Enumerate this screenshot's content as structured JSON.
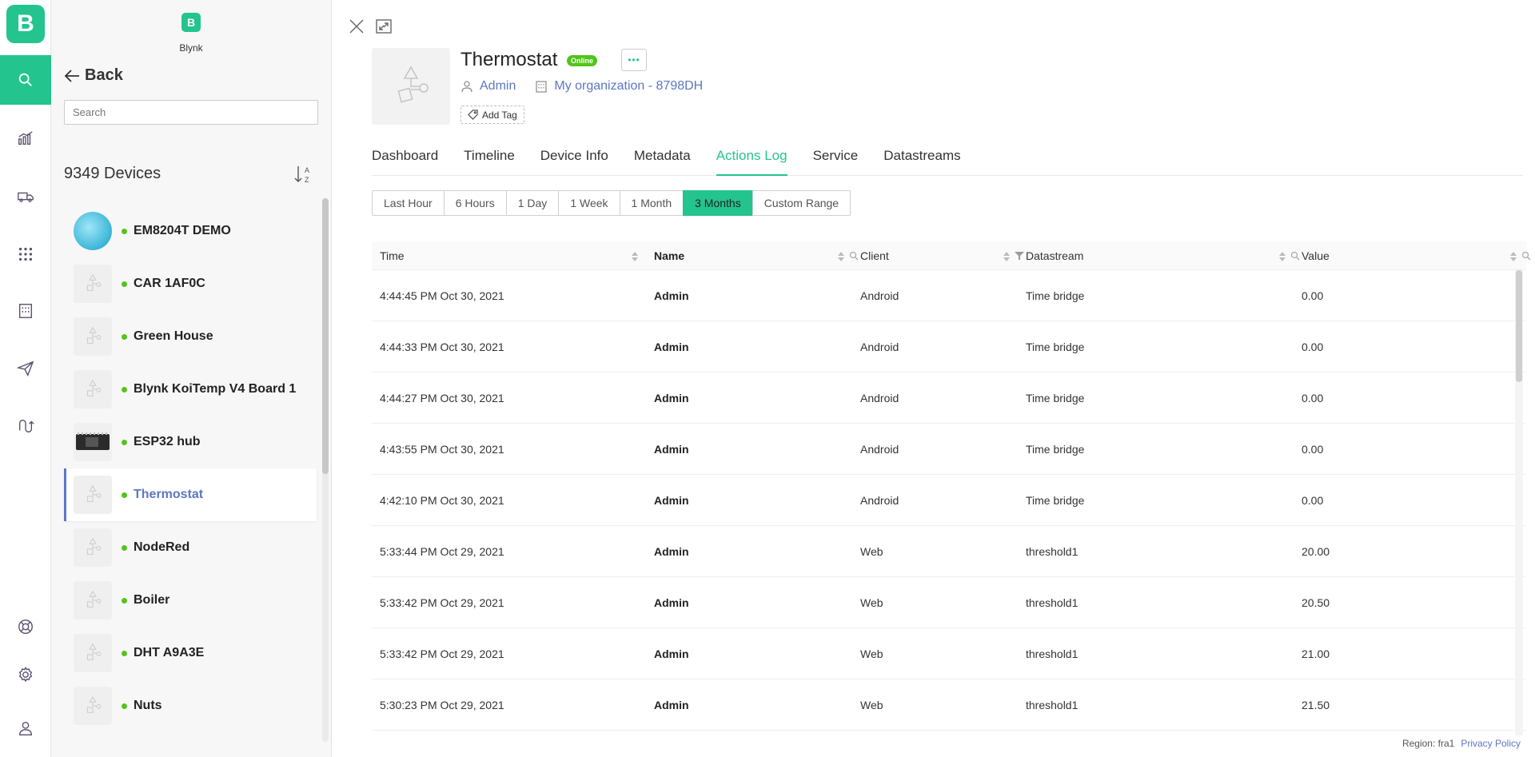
{
  "rail": {
    "logo": "B",
    "items": [
      "search-icon",
      "analytics-icon",
      "truck-icon",
      "apps-icon",
      "building-icon",
      "send-icon",
      "automation-icon"
    ],
    "bottom_items": [
      "help-icon",
      "settings-icon",
      "user-icon"
    ],
    "active_color": "#23c48e"
  },
  "org": {
    "logo": "B",
    "name": "Blynk"
  },
  "panel": {
    "back_label": "Back",
    "search_placeholder": "Search",
    "device_count": "9349 Devices"
  },
  "devices": [
    {
      "name": "EM8204T DEMO",
      "status": "online",
      "thumb": "globe"
    },
    {
      "name": "CAR 1AF0C",
      "status": "online",
      "thumb": "placeholder"
    },
    {
      "name": "Green House",
      "status": "online",
      "thumb": "placeholder"
    },
    {
      "name": "Blynk KoiTemp V4 Board 1",
      "status": "online",
      "thumb": "placeholder"
    },
    {
      "name": "ESP32 hub",
      "status": "online",
      "thumb": "board"
    },
    {
      "name": "Thermostat",
      "status": "online",
      "thumb": "placeholder",
      "selected": true
    },
    {
      "name": "NodeRed",
      "status": "online",
      "thumb": "placeholder"
    },
    {
      "name": "Boiler",
      "status": "online",
      "thumb": "placeholder"
    },
    {
      "name": "DHT A9A3E",
      "status": "online",
      "thumb": "placeholder"
    },
    {
      "name": "Nuts",
      "status": "online",
      "thumb": "placeholder"
    }
  ],
  "device": {
    "title": "Thermostat",
    "status_badge": "Online",
    "owner": "Admin",
    "organization": "My organization - 8798DH",
    "add_tag": "Add Tag"
  },
  "tabs": [
    "Dashboard",
    "Timeline",
    "Device Info",
    "Metadata",
    "Actions Log",
    "Service",
    "Datastreams"
  ],
  "active_tab": "Actions Log",
  "ranges": [
    "Last Hour",
    "6 Hours",
    "1 Day",
    "1 Week",
    "1 Month",
    "3 Months",
    "Custom Range"
  ],
  "active_range": "3 Months",
  "table": {
    "columns": [
      "Time",
      "Name",
      "Client",
      "Datastream",
      "Value"
    ],
    "rows": [
      [
        "4:44:45 PM Oct 30, 2021",
        "Admin",
        "Android",
        "Time bridge",
        "0.00"
      ],
      [
        "4:44:33 PM Oct 30, 2021",
        "Admin",
        "Android",
        "Time bridge",
        "0.00"
      ],
      [
        "4:44:27 PM Oct 30, 2021",
        "Admin",
        "Android",
        "Time bridge",
        "0.00"
      ],
      [
        "4:43:55 PM Oct 30, 2021",
        "Admin",
        "Android",
        "Time bridge",
        "0.00"
      ],
      [
        "4:42:10 PM Oct 30, 2021",
        "Admin",
        "Android",
        "Time bridge",
        "0.00"
      ],
      [
        "5:33:44 PM Oct 29, 2021",
        "Admin",
        "Web",
        "threshold1",
        "20.00"
      ],
      [
        "5:33:42 PM Oct 29, 2021",
        "Admin",
        "Web",
        "threshold1",
        "20.50"
      ],
      [
        "5:33:42 PM Oct 29, 2021",
        "Admin",
        "Web",
        "threshold1",
        "21.00"
      ],
      [
        "5:30:23 PM Oct 29, 2021",
        "Admin",
        "Web",
        "threshold1",
        "21.50"
      ]
    ]
  },
  "footer": {
    "region": "Region: fra1",
    "privacy": "Privacy Policy"
  }
}
